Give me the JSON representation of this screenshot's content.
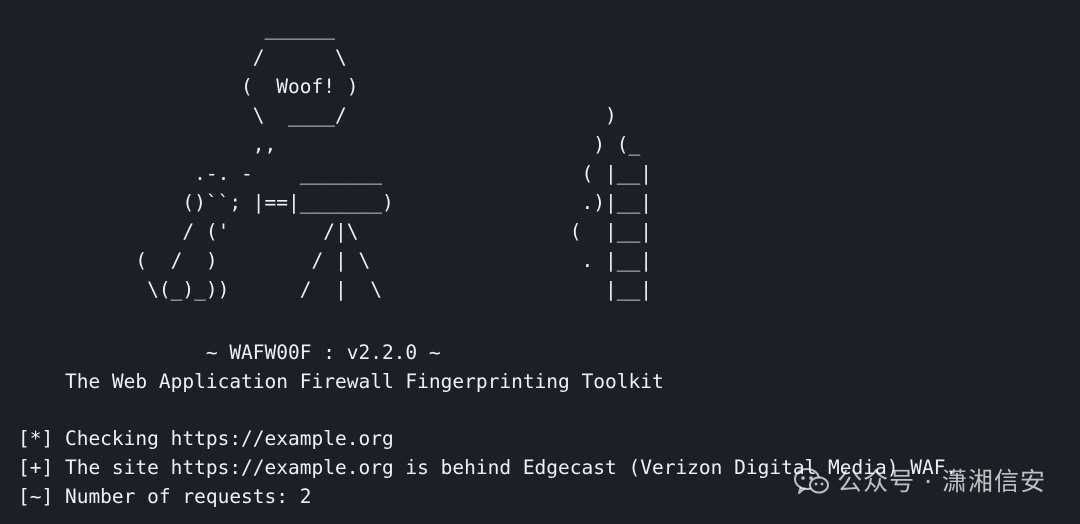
{
  "ascii_art": {
    "lines": [
      "                     ______",
      "                    /      \\",
      "                   (  Woof! )",
      "                    \\  ____/                      )",
      "                    ,,                           ) (_",
      "               .-. -    _______                 ( |__|",
      "              ()``; |==|_______)                .)|__|",
      "              / ('        /|\\                  (  |__|",
      "          (  /  )        / | \\                  . |__|",
      "           \\(_)_))      /  |  \\                   |__|"
    ]
  },
  "banner": {
    "title": "                ~ WAFW00F : v2.2.0 ~",
    "subtitle": "    The Web Application Firewall Fingerprinting Toolkit"
  },
  "log": {
    "lines": [
      "[*] Checking https://example.org",
      "[+] The site https://example.org is behind Edgecast (Verizon Digital Media) WAF.",
      "[~] Number of requests: 2"
    ]
  },
  "watermark": {
    "text": "公众号 · 潇湘信安",
    "icon": "wechat-icon"
  }
}
